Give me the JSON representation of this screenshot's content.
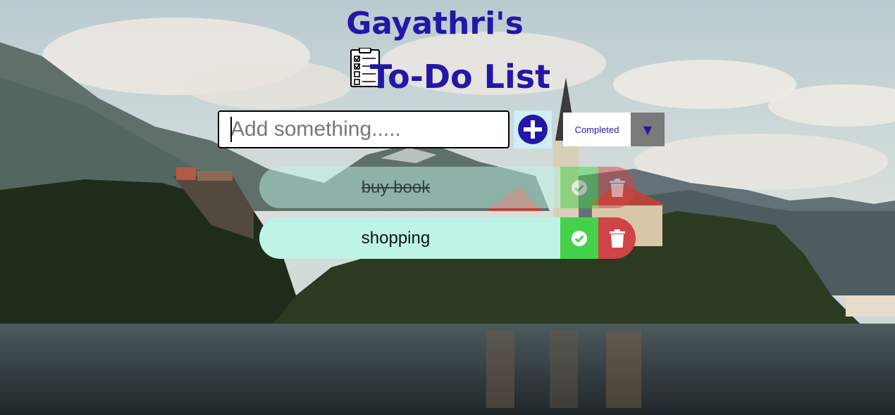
{
  "header": {
    "title_line1": "Gayathri's",
    "title_line2": "To-Do List",
    "title_color": "#2316a8"
  },
  "form": {
    "input_placeholder": "Add something.....",
    "input_value": "",
    "add_icon": "plus-circle-icon",
    "filter_selected": "Completed",
    "filter_arrow": "▼"
  },
  "todos": [
    {
      "text": "buy book",
      "completed": true
    },
    {
      "text": "shopping",
      "completed": false
    }
  ],
  "colors": {
    "accent": "#2316a8",
    "todo_bg": "#bdf4e6",
    "check_bg": "#45d24a",
    "trash_bg": "#cf4447"
  }
}
